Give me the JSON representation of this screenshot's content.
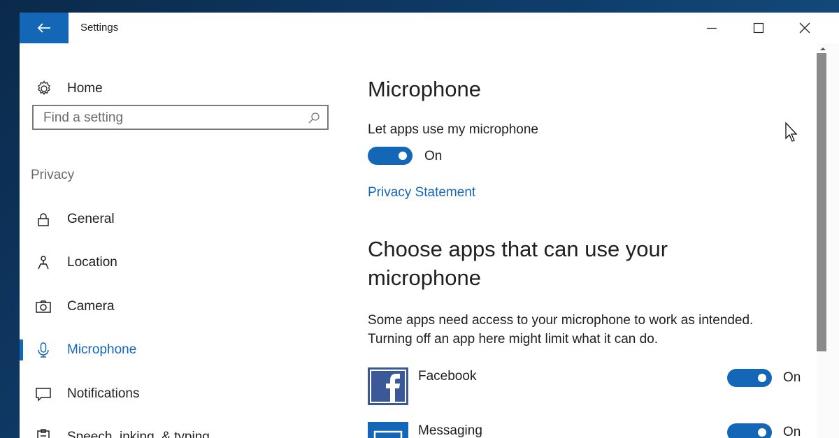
{
  "window": {
    "title": "Settings",
    "controls": {
      "minimize": "minimize",
      "maximize": "maximize",
      "close": "close"
    },
    "accent": "#1467b6"
  },
  "sidebar": {
    "home_label": "Home",
    "search_placeholder": "Find a setting",
    "section": "Privacy",
    "items": [
      {
        "label": "General",
        "icon": "lock-icon",
        "active": false
      },
      {
        "label": "Location",
        "icon": "location-icon",
        "active": false
      },
      {
        "label": "Camera",
        "icon": "camera-icon",
        "active": false
      },
      {
        "label": "Microphone",
        "icon": "microphone-icon",
        "active": true
      },
      {
        "label": "Notifications",
        "icon": "notifications-icon",
        "active": false
      },
      {
        "label": "Speech, inking, & typing",
        "icon": "speech-icon",
        "active": false
      }
    ]
  },
  "main": {
    "title": "Microphone",
    "allow_label": "Let apps use my microphone",
    "allow_state": "On",
    "privacy_link": "Privacy Statement",
    "apps_heading": "Choose apps that can use your microphone",
    "apps_description_line1": "Some apps need access to your microphone to work as intended.",
    "apps_description_line2": "Turning off an app here might limit what it can do.",
    "apps": [
      {
        "name": "Facebook",
        "state": "On",
        "icon": "facebook-icon",
        "color": "#3b5998"
      },
      {
        "name": "Messaging",
        "state": "On",
        "icon": "messaging-icon",
        "color": "#1467b6"
      }
    ]
  }
}
